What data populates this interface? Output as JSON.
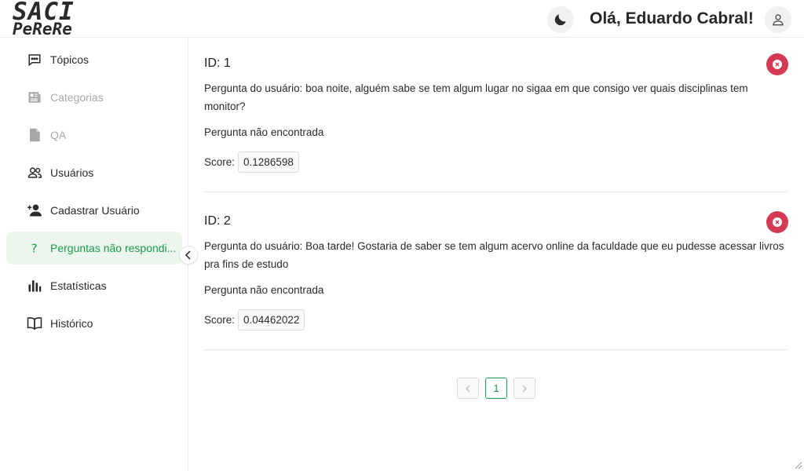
{
  "header": {
    "logo_line1": "SACI",
    "logo_line2": "PeReRe",
    "greeting": "Olá, Eduardo Cabral!"
  },
  "sidebar": {
    "items": [
      {
        "label": "Tópicos",
        "icon": "chat-icon",
        "state": "normal"
      },
      {
        "label": "Categorias",
        "icon": "newspaper-icon",
        "state": "disabled"
      },
      {
        "label": "QA",
        "icon": "file-icon",
        "state": "disabled"
      },
      {
        "label": "Usuários",
        "icon": "users-icon",
        "state": "normal"
      },
      {
        "label": "Cadastrar Usuário",
        "icon": "user-add-icon",
        "state": "normal"
      },
      {
        "label": "Perguntas não respondi...",
        "icon": "question-icon",
        "state": "active"
      },
      {
        "label": "Estatísticas",
        "icon": "bar-chart-icon",
        "state": "normal"
      },
      {
        "label": "Histórico",
        "icon": "book-icon",
        "state": "normal"
      }
    ]
  },
  "questions": [
    {
      "id_label": "ID: 1",
      "question": "Pergunta do usuário: boa noite, alguém sabe se tem algum lugar no sigaa em que consigo ver quais disciplinas tem monitor?",
      "answer": "Pergunta não encontrada",
      "score_label": "Score:",
      "score": "0.1286598"
    },
    {
      "id_label": "ID: 2",
      "question": "Pergunta do usuário: Boa tarde! Gostaria de saber se tem algum acervo online da faculdade que eu pudesse acessar livros pra fins de estudo",
      "answer": "Pergunta não encontrada",
      "score_label": "Score:",
      "score": "0.04462022"
    }
  ],
  "pagination": {
    "current_page": "1"
  },
  "colors": {
    "accent": "#1b9a4a",
    "active_bg": "#ecf6ef",
    "danger": "#d53a55"
  }
}
